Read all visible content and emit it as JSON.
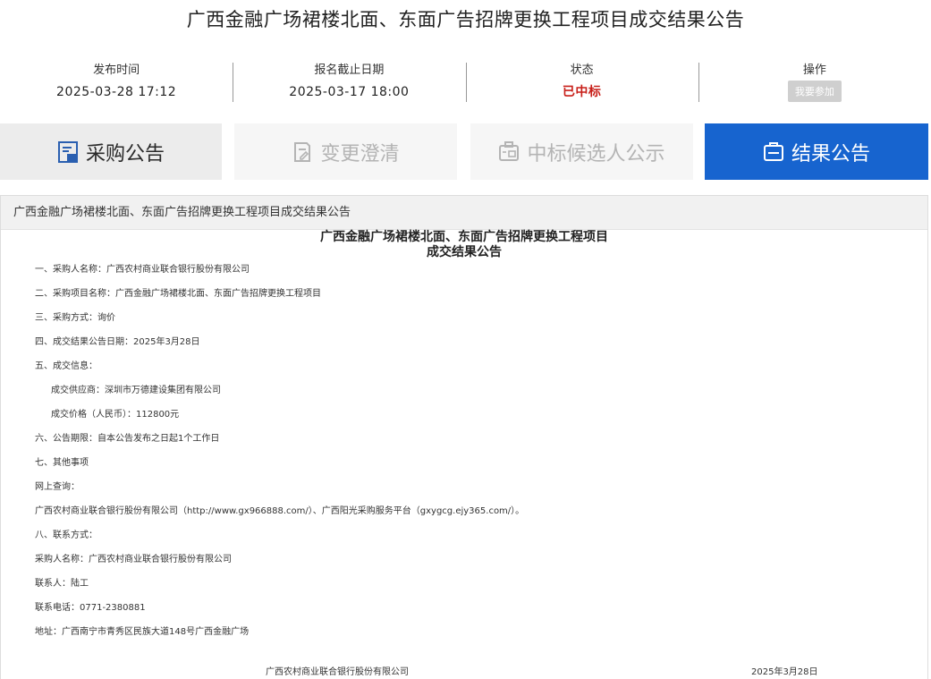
{
  "page": {
    "title": "广西金融广场裙楼北面、东面广告招牌更换工程项目成交结果公告"
  },
  "info": {
    "publish_label": "发布时间",
    "publish_value": "2025-03-28 17:12",
    "deadline_label": "报名截止日期",
    "deadline_value": "2025-03-17 18:00",
    "status_label": "状态",
    "status_value": "已中标",
    "status_color": "#c8201a",
    "action_label": "操作",
    "action_button": "我要参加"
  },
  "tabs": [
    {
      "label": "采购公告",
      "icon": "document-icon",
      "state": "normal"
    },
    {
      "label": "变更澄清",
      "icon": "edit-document-icon",
      "state": "disabled"
    },
    {
      "label": "中标候选人公示",
      "icon": "id-card-icon",
      "state": "disabled"
    },
    {
      "label": "结果公告",
      "icon": "clipboard-icon",
      "state": "active"
    }
  ],
  "accent_color": "#1764cf",
  "content": {
    "header": "广西金融广场裙楼北面、东面广告招牌更换工程项目成交结果公告",
    "doc_title_line1": "广西金融广场裙楼北面、东面广告招牌更换工程项目",
    "doc_title_line2": "成交结果公告",
    "lines": [
      "一、采购人名称：广西农村商业联合银行股份有限公司",
      "二、采购项目名称：广西金融广场裙楼北面、东面广告招牌更换工程项目",
      "三、采购方式：询价",
      "四、成交结果公告日期：2025年3月28日",
      "五、成交信息：",
      "成交供应商：深圳市万德建设集团有限公司",
      "成交价格（人民币）：112800元",
      "六、公告期限：自本公告发布之日起1个工作日",
      "七、其他事项",
      "网上查询：",
      "广西农村商业联合银行股份有限公司（http://www.gx966888.com/）、广西阳光采购服务平台（gxygcg.ejy365.com/）。",
      "八、联系方式：",
      "采购人名称：广西农村商业联合银行股份有限公司",
      "联系人：陆工",
      "联系电话：0771-2380881",
      "地址：广西南宁市青秀区民族大道148号广西金融广场"
    ],
    "footer_org": "广西农村商业联合银行股份有限公司",
    "footer_date": "2025年3月28日"
  }
}
